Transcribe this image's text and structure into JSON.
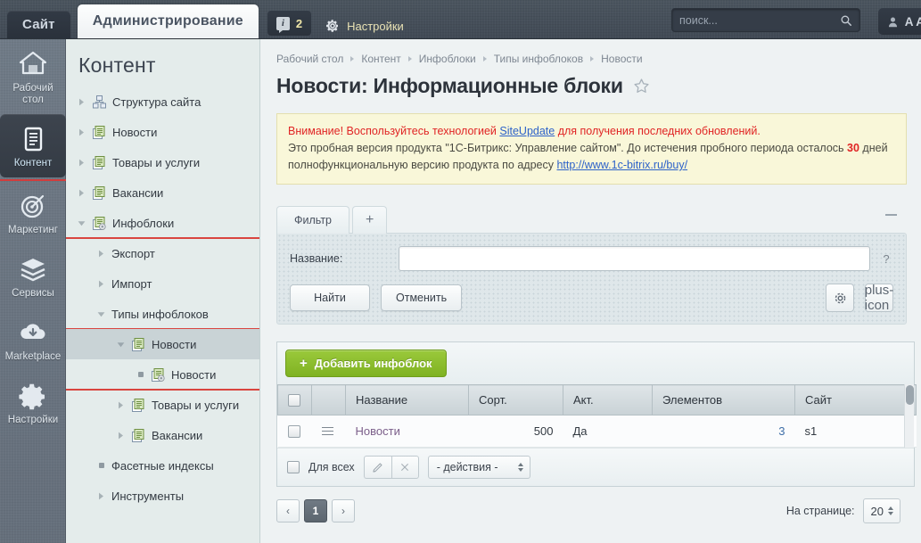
{
  "topbar": {
    "tab_site": "Сайт",
    "tab_admin": "Администрирование",
    "notify_count": "2",
    "notify_icon": "info-icon",
    "settings_label": "Настройки",
    "settings_icon": "gear-icon",
    "search_placeholder": "поиск...",
    "search_value": "",
    "search_icon": "magnifier-icon",
    "user_label": "A A",
    "user_icon": "user-icon"
  },
  "rail": {
    "items": [
      {
        "label": "Рабочий стол",
        "icon": "home-icon",
        "active": false
      },
      {
        "label": "Контент",
        "icon": "document-icon",
        "active": true
      },
      {
        "label": "Маркетинг",
        "icon": "target-icon",
        "active": false
      },
      {
        "label": "Сервисы",
        "icon": "layers-icon",
        "active": false
      },
      {
        "label": "Marketplace",
        "icon": "cloud-download-icon",
        "active": false
      },
      {
        "label": "Настройки",
        "icon": "gear-icon",
        "active": false
      }
    ],
    "accent_color": "#d23c3c"
  },
  "tree": {
    "title": "Контент",
    "nodes": [
      {
        "label": "Структура сайта",
        "indent": 0,
        "marker": "arrow-right-icon",
        "icon": "sitemap-icon"
      },
      {
        "label": "Новости",
        "indent": 0,
        "marker": "arrow-right-icon",
        "icon": "iblock-icon"
      },
      {
        "label": "Товары и услуги",
        "indent": 0,
        "marker": "arrow-right-icon",
        "icon": "iblock-icon"
      },
      {
        "label": "Вакансии",
        "indent": 0,
        "marker": "arrow-right-icon",
        "icon": "iblock-icon"
      },
      {
        "label": "Инфоблоки",
        "indent": 0,
        "marker": "arrow-down-icon",
        "icon": "iblock-gear-icon",
        "underline": true
      },
      {
        "label": "Экспорт",
        "indent": 1,
        "marker": "arrow-right-icon",
        "icon": "none"
      },
      {
        "label": "Импорт",
        "indent": 1,
        "marker": "arrow-right-icon",
        "icon": "none"
      },
      {
        "label": "Типы инфоблоков",
        "indent": 1,
        "marker": "arrow-down-icon",
        "icon": "none",
        "underline": true
      },
      {
        "label": "Новости",
        "indent": 2,
        "marker": "arrow-down-icon",
        "icon": "iblock-icon",
        "selected": true
      },
      {
        "label": "Новости",
        "indent": 3,
        "marker": "dot-icon",
        "icon": "iblock-gear-icon",
        "underline": true
      },
      {
        "label": "Товары и услуги",
        "indent": 2,
        "marker": "arrow-right-icon",
        "icon": "iblock-icon"
      },
      {
        "label": "Вакансии",
        "indent": 2,
        "marker": "arrow-right-icon",
        "icon": "iblock-icon"
      },
      {
        "label": "Фасетные индексы",
        "indent": 1,
        "marker": "dot-icon",
        "icon": "none"
      },
      {
        "label": "Инструменты",
        "indent": 1,
        "marker": "arrow-right-icon",
        "icon": "none"
      }
    ]
  },
  "breadcrumb": [
    "Рабочий стол",
    "Контент",
    "Инфоблоки",
    "Типы инфоблоков",
    "Новости"
  ],
  "page": {
    "title": "Новости: Информационные блоки",
    "star_icon": "star-outline-icon"
  },
  "notice": {
    "line1_pre": "Внимание! Воспользуйтесь технологией ",
    "line1_link": "SiteUpdate",
    "line1_post": " для получения последних обновлений.",
    "line2_pre": "Это пробная версия продукта \"1С-Битрикс: Управление сайтом\". До истечения пробного периода осталось ",
    "line2_days": "30",
    "line2_post": " дней",
    "line3_pre": "полнофункциональную версию продукта по адресу ",
    "line3_link": "http://www.1c-bitrix.ru/buy/"
  },
  "filter": {
    "tab_label": "Фильтр",
    "tab_plus": "+",
    "collapse_icon": "minus-icon",
    "field_label": "Название:",
    "field_value": "",
    "help_icon": "?",
    "btn_find": "Найти",
    "btn_cancel": "Отменить",
    "btn_settings_icon": "gear-icon",
    "btn_add_icon": "plus-icon"
  },
  "grid": {
    "add_button": "Добавить инфоблок",
    "add_button_icon": "plus-icon",
    "columns": [
      "",
      "",
      "Название",
      "Сорт.",
      "Акт.",
      "Элементов",
      "Сайт"
    ],
    "rows": [
      {
        "checkbox": false,
        "menu_icon": "burger-menu-icon",
        "name": "Новости",
        "sort": "500",
        "active": "Да",
        "elements": "3",
        "site": "s1"
      }
    ],
    "action_bar": {
      "select_all_label": "Для всех",
      "edit_icon": "pencil-icon",
      "delete_icon": "cross-icon",
      "actions_label": "- действия -"
    }
  },
  "pager": {
    "prev": "‹",
    "current": "1",
    "next": "›",
    "per_page_label": "На странице:",
    "per_page_value": "20"
  }
}
